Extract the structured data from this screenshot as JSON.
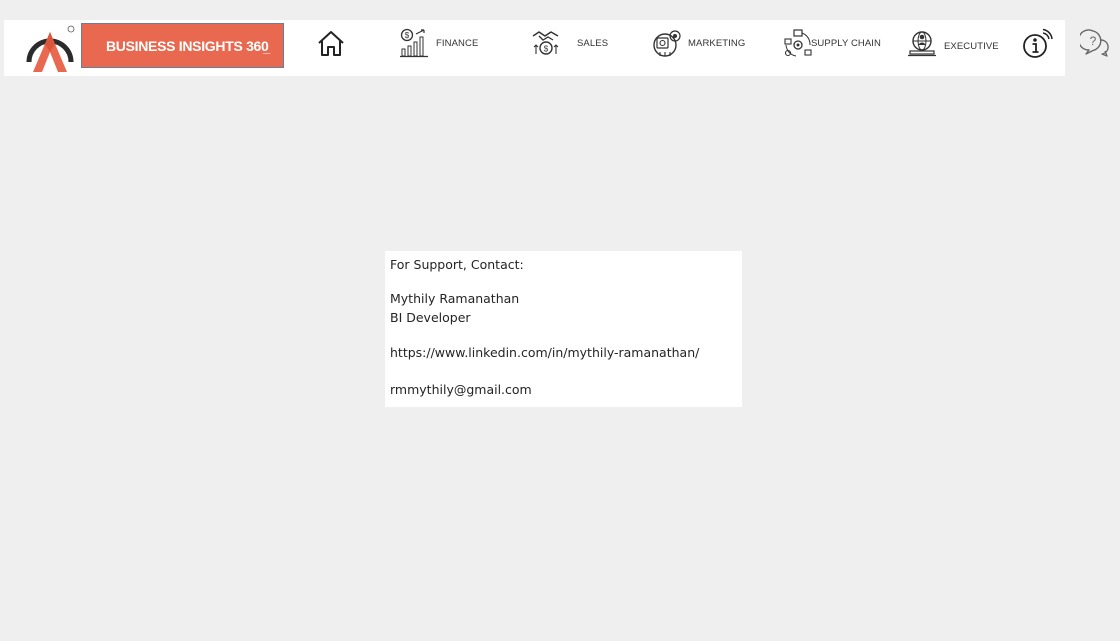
{
  "header": {
    "brand_title": "BUSINESS INSIGHTS 360",
    "brand_suffix": "_",
    "logo_mark": "®"
  },
  "nav": {
    "home_icon": "home-icon",
    "items": [
      {
        "label": "FINANCE",
        "icon": "finance-chart-icon"
      },
      {
        "label": "SALES",
        "icon": "sales-handshake-icon"
      },
      {
        "label": "MARKETING",
        "icon": "marketing-icon"
      },
      {
        "label": "SUPPLY CHAIN",
        "icon": "supply-chain-icon"
      },
      {
        "label": "EXECUTIVE",
        "icon": "executive-globe-icon"
      }
    ],
    "info_icon": "info-icon",
    "support_icon": "support-question-icon"
  },
  "support": {
    "heading": "For Support, Contact:",
    "name": "Mythily Ramanathan",
    "role": "BI Developer",
    "linkedin": "https://www.linkedin.com/in/mythily-ramanathan/",
    "email": "rmmythily@gmail.com"
  },
  "colors": {
    "brand_accent": "#e8694f",
    "page_background": "#efefef",
    "panel_background": "#ffffff"
  }
}
